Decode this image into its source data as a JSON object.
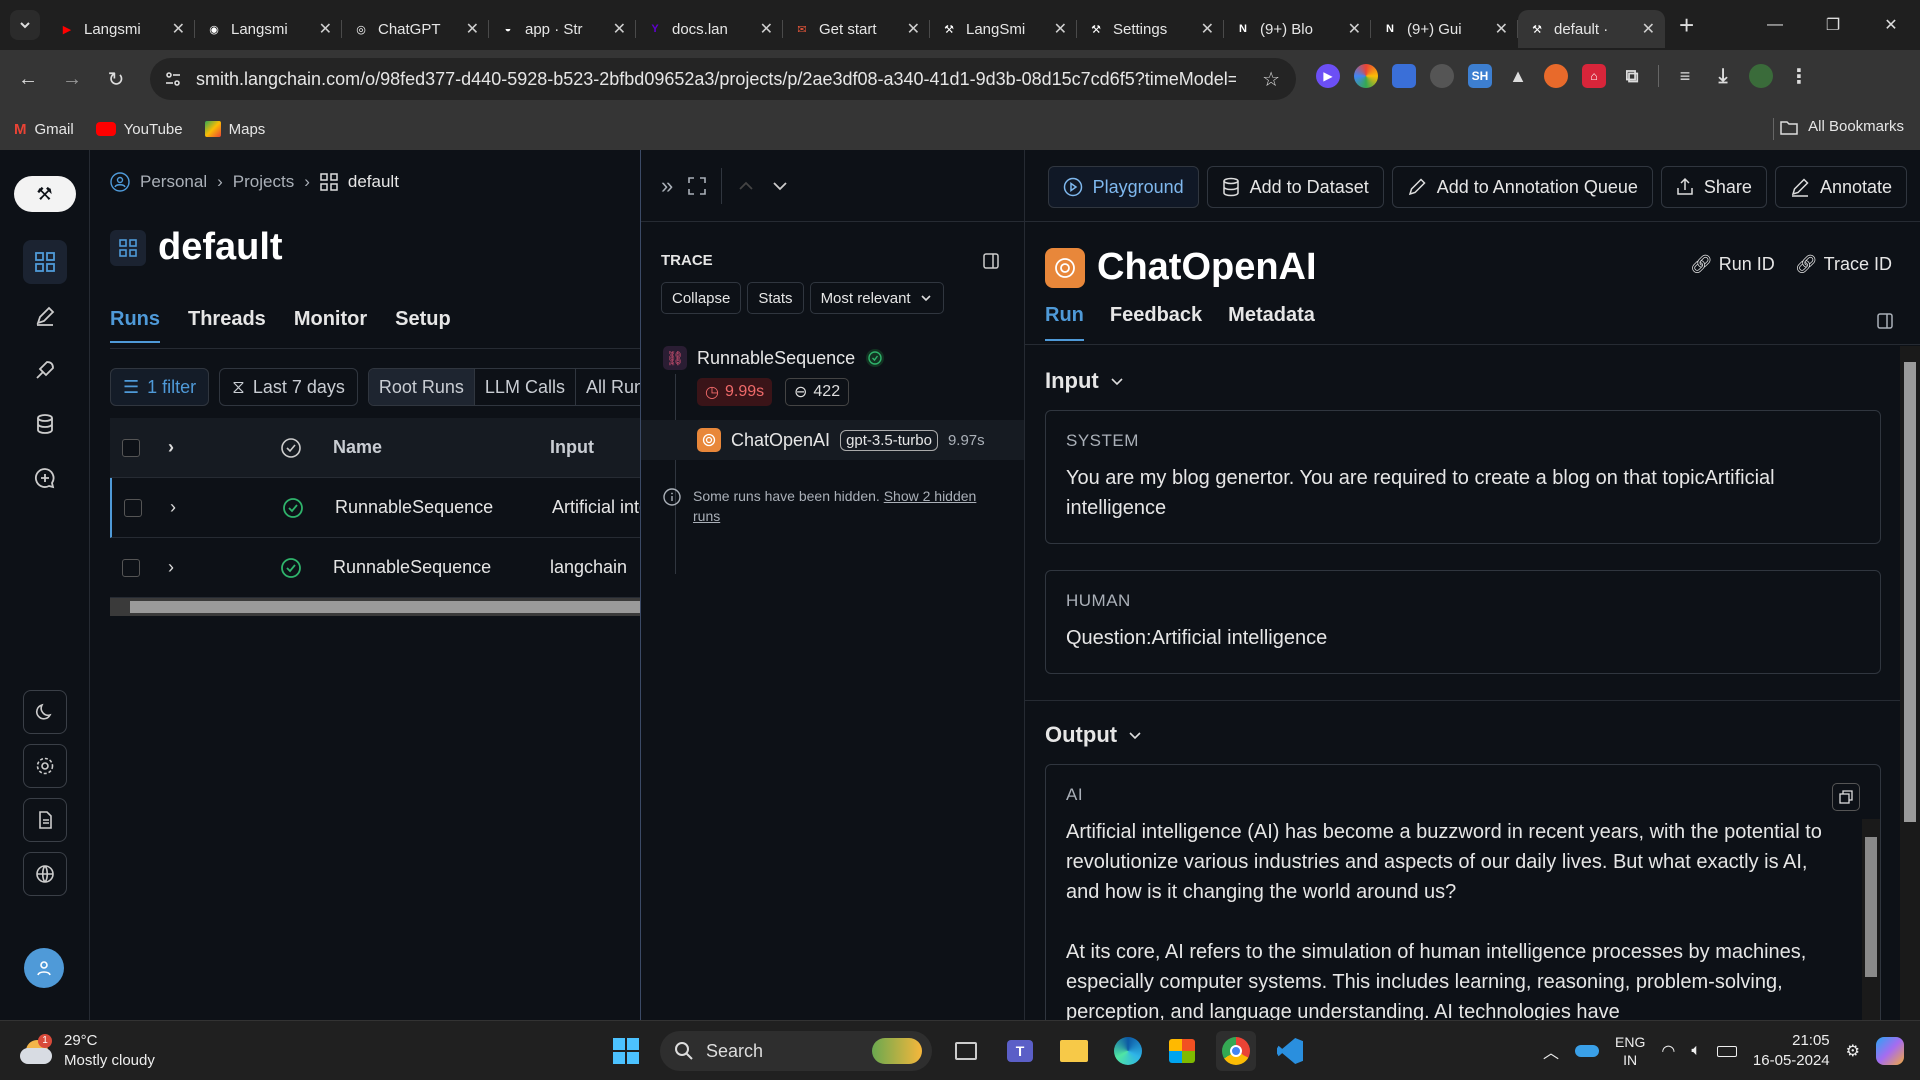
{
  "browser": {
    "tabs": [
      {
        "label": "Langsmi",
        "icon": "youtube-icon",
        "color": "#ff0000"
      },
      {
        "label": "Langsmi",
        "icon": "github-icon",
        "color": "#ffffff"
      },
      {
        "label": "ChatGPT",
        "icon": "openai-icon",
        "color": "#ffffff"
      },
      {
        "label": "app · Str",
        "icon": "streamlit-icon",
        "color": "#ffffff"
      },
      {
        "label": "docs.lan",
        "icon": "yahoo-icon",
        "color": "#6001d2"
      },
      {
        "label": "Get start",
        "icon": "mail-icon",
        "color": "#e8563a"
      },
      {
        "label": "LangSmi",
        "icon": "langsmith-icon",
        "color": "#ffffff"
      },
      {
        "label": "Settings",
        "icon": "langsmith-icon",
        "color": "#ffffff"
      },
      {
        "label": "(9+) Blo",
        "icon": "notion-icon",
        "color": "#ffffff"
      },
      {
        "label": "(9+) Gui",
        "icon": "notion-icon",
        "color": "#ffffff"
      },
      {
        "label": "default ·",
        "icon": "langsmith-icon",
        "color": "#ffffff",
        "active": true
      }
    ],
    "url": "smith.langchain.com/o/98fed377-d440-5928-b523-2bfbd09652a3/projects/p/2ae3df08-a340-41d1-9d3b-08d15c7cd6f5?timeModel=...",
    "bookmarks": [
      "Gmail",
      "YouTube",
      "Maps"
    ],
    "all_bookmarks": "All Bookmarks"
  },
  "runs_panel": {
    "breadcrumb": [
      "Personal",
      "Projects",
      "default"
    ],
    "title": "default",
    "tabs": [
      "Runs",
      "Threads",
      "Monitor",
      "Setup"
    ],
    "active_tab": "Runs",
    "filter_label": "1 filter",
    "time_label": "Last 7 days",
    "segments": [
      "Root Runs",
      "LLM Calls",
      "All Runs"
    ],
    "columns": {
      "name": "Name",
      "input": "Input"
    },
    "rows": [
      {
        "name": "RunnableSequence",
        "input": "Artificial intelligence",
        "status": "success"
      },
      {
        "name": "RunnableSequence",
        "input": "langchain",
        "status": "success"
      }
    ]
  },
  "trace_panel": {
    "label": "TRACE",
    "buttons": {
      "collapse": "Collapse",
      "stats": "Stats",
      "sort": "Most relevant"
    },
    "root": {
      "name": "RunnableSequence",
      "latency": "9.99s",
      "tokens": "422"
    },
    "child": {
      "name": "ChatOpenAI",
      "model": "gpt-3.5-turbo",
      "latency": "9.97s"
    },
    "hidden_note": "Some runs have been hidden.",
    "hidden_link": "Show 2 hidden runs"
  },
  "detail_panel": {
    "actions": {
      "playground": "Playground",
      "dataset": "Add to Dataset",
      "queue": "Add to Annotation Queue",
      "share": "Share",
      "annotate": "Annotate"
    },
    "title": "ChatOpenAI",
    "run_id": "Run ID",
    "trace_id": "Trace ID",
    "tabs": [
      "Run",
      "Feedback",
      "Metadata"
    ],
    "input_label": "Input",
    "system_role": "SYSTEM",
    "system_text": "You are my blog genertor. You are required to create a blog on that topicArtificial intelligence",
    "human_role": "HUMAN",
    "human_text": "Question:Artificial intelligence",
    "output_label": "Output",
    "ai_role": "AI",
    "ai_text_1": "Artificial intelligence (AI) has become a buzzword in recent years, with the potential to revolutionize various industries and aspects of our daily lives. But what exactly is AI, and how is it changing the world around us?",
    "ai_text_2": "At its core, AI refers to the simulation of human intelligence processes by machines, especially computer systems. This includes learning, reasoning, problem-solving, perception, and language understanding. AI technologies have"
  },
  "taskbar": {
    "temp": "29°C",
    "weather": "Mostly cloudy",
    "weather_badge": "1",
    "search": "Search",
    "lang_top": "ENG",
    "lang_bottom": "IN",
    "time": "21:05",
    "date": "16-05-2024"
  }
}
